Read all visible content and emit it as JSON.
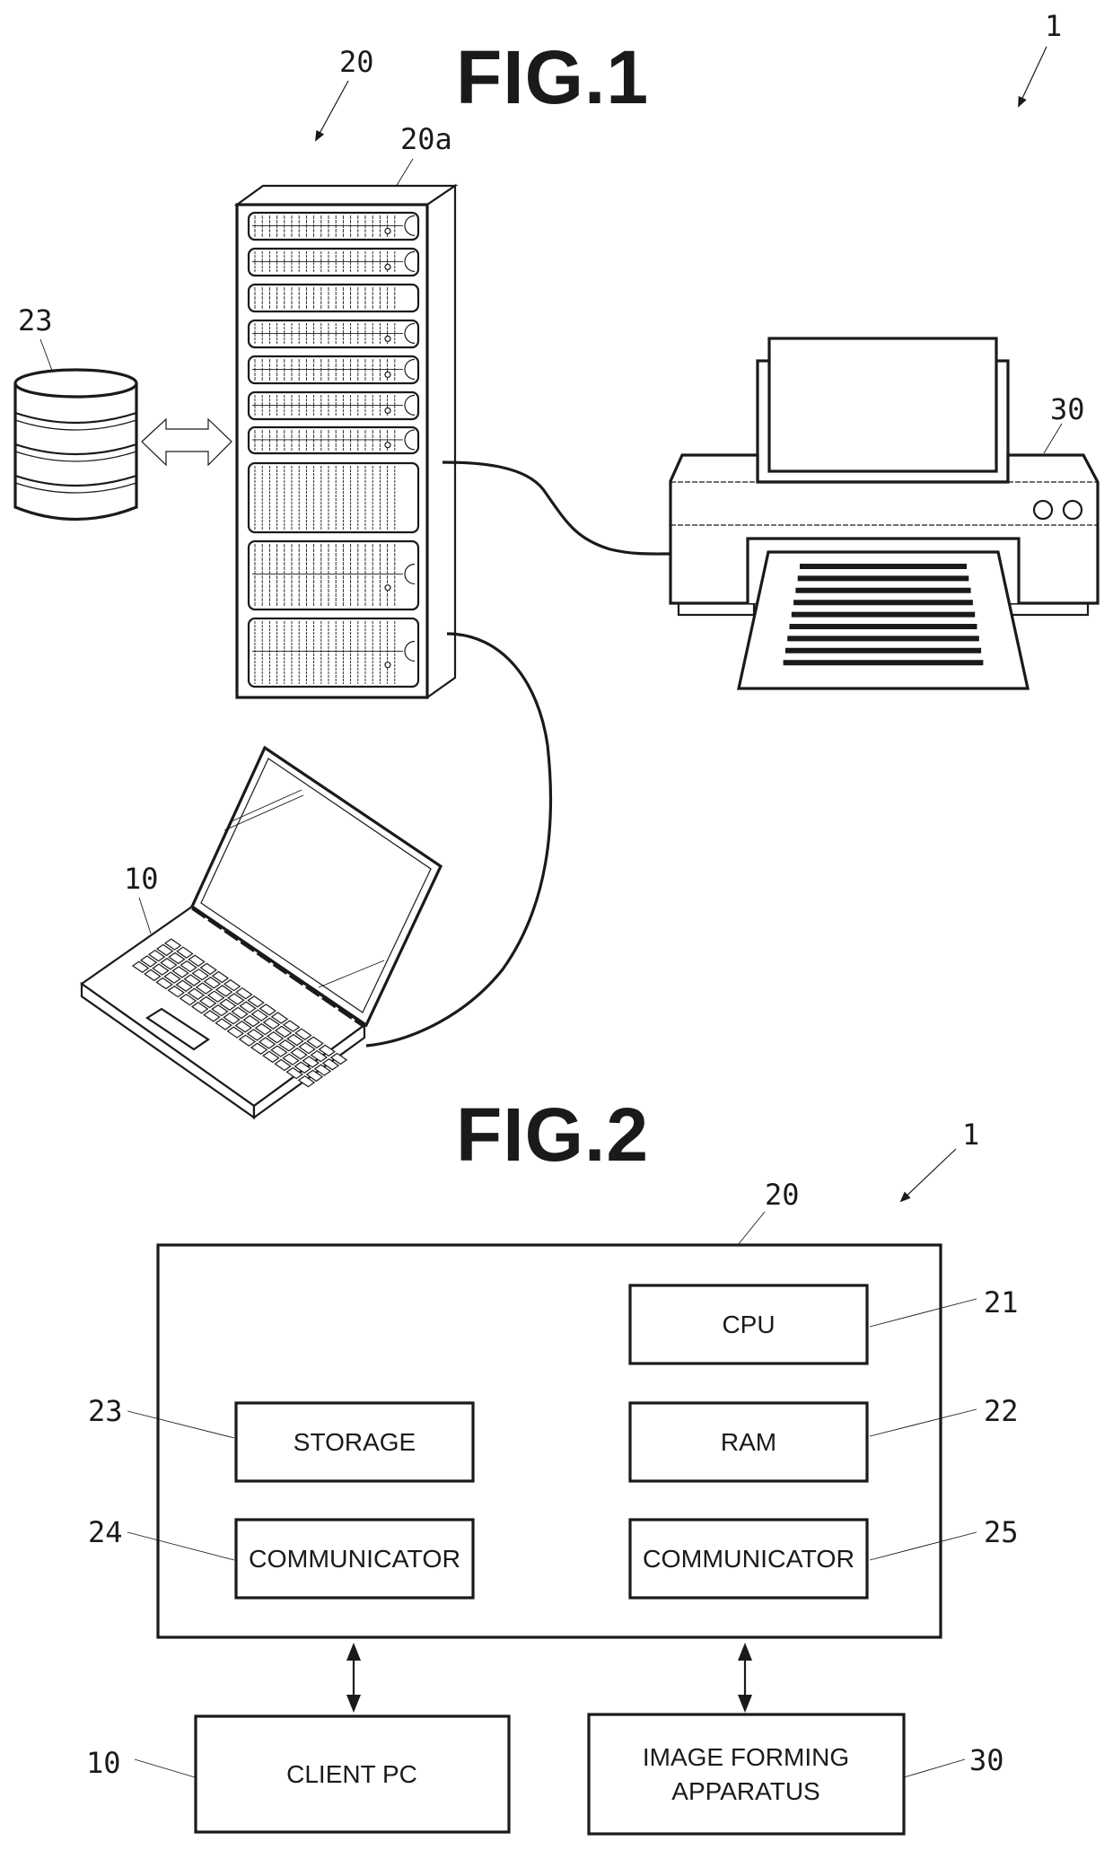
{
  "fig1": {
    "title": "FIG.1",
    "system_ref": "1",
    "server_ref": "20",
    "server_rack_ref": "20a",
    "storage_ref": "23",
    "printer_ref": "30",
    "client_ref": "10",
    "server_drive_bays": 10,
    "printed_page_lines": 9
  },
  "fig2": {
    "title": "FIG.2",
    "system_ref": "1",
    "server_ref": "20",
    "blocks": {
      "cpu": {
        "label": "CPU",
        "ref": "21"
      },
      "ram": {
        "label": "RAM",
        "ref": "22"
      },
      "storage": {
        "label": "STORAGE",
        "ref": "23"
      },
      "communicator_left": {
        "label": "COMMUNICATOR",
        "ref": "24"
      },
      "communicator_right": {
        "label": "COMMUNICATOR",
        "ref": "25"
      },
      "client_pc": {
        "label": "CLIENT PC",
        "ref": "10"
      },
      "image_forming": {
        "label_line1": "IMAGE FORMING",
        "label_line2": "APPARATUS",
        "ref": "30"
      }
    }
  }
}
